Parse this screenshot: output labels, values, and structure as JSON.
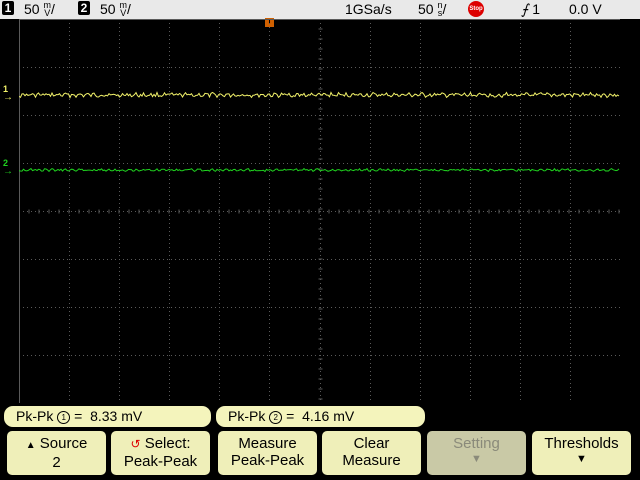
{
  "status": {
    "ch1_number": "1",
    "ch1_scale": "50",
    "ch1_unit_top": "m",
    "ch1_unit_bottom": "V",
    "ch2_number": "2",
    "ch2_scale": "50",
    "ch2_unit_top": "m",
    "ch2_unit_bottom": "V",
    "sample_rate": "1GSa/s",
    "timebase": "50",
    "time_unit_top": "n",
    "time_unit_bottom": "s",
    "run_state": "Stop",
    "trigger_source": "1",
    "trigger_level": "0.0 V"
  },
  "markers": {
    "ch1": "1",
    "ch2": "2",
    "trigger": "T"
  },
  "measurements": [
    {
      "label": "Pk-Pk",
      "channel": "1",
      "value": "8.33 mV"
    },
    {
      "label": "Pk-Pk",
      "channel": "2",
      "value": "4.16 mV"
    }
  ],
  "softkeys": {
    "source_line1": "Source",
    "source_line2": "2",
    "select_line1": "Select:",
    "select_line2": "Peak-Peak",
    "measure_line1": "Measure",
    "measure_line2": "Peak-Peak",
    "clear_line1": "Clear",
    "clear_line2": "Measure",
    "setting_line1": "Setting",
    "thresholds_line1": "Thresholds"
  },
  "colors": {
    "ch1": "#f2f26a",
    "ch2": "#1fd11f",
    "grid": "#5a5a5a",
    "softkey": "#efefb9",
    "measure_bar": "#f4f4bc"
  }
}
